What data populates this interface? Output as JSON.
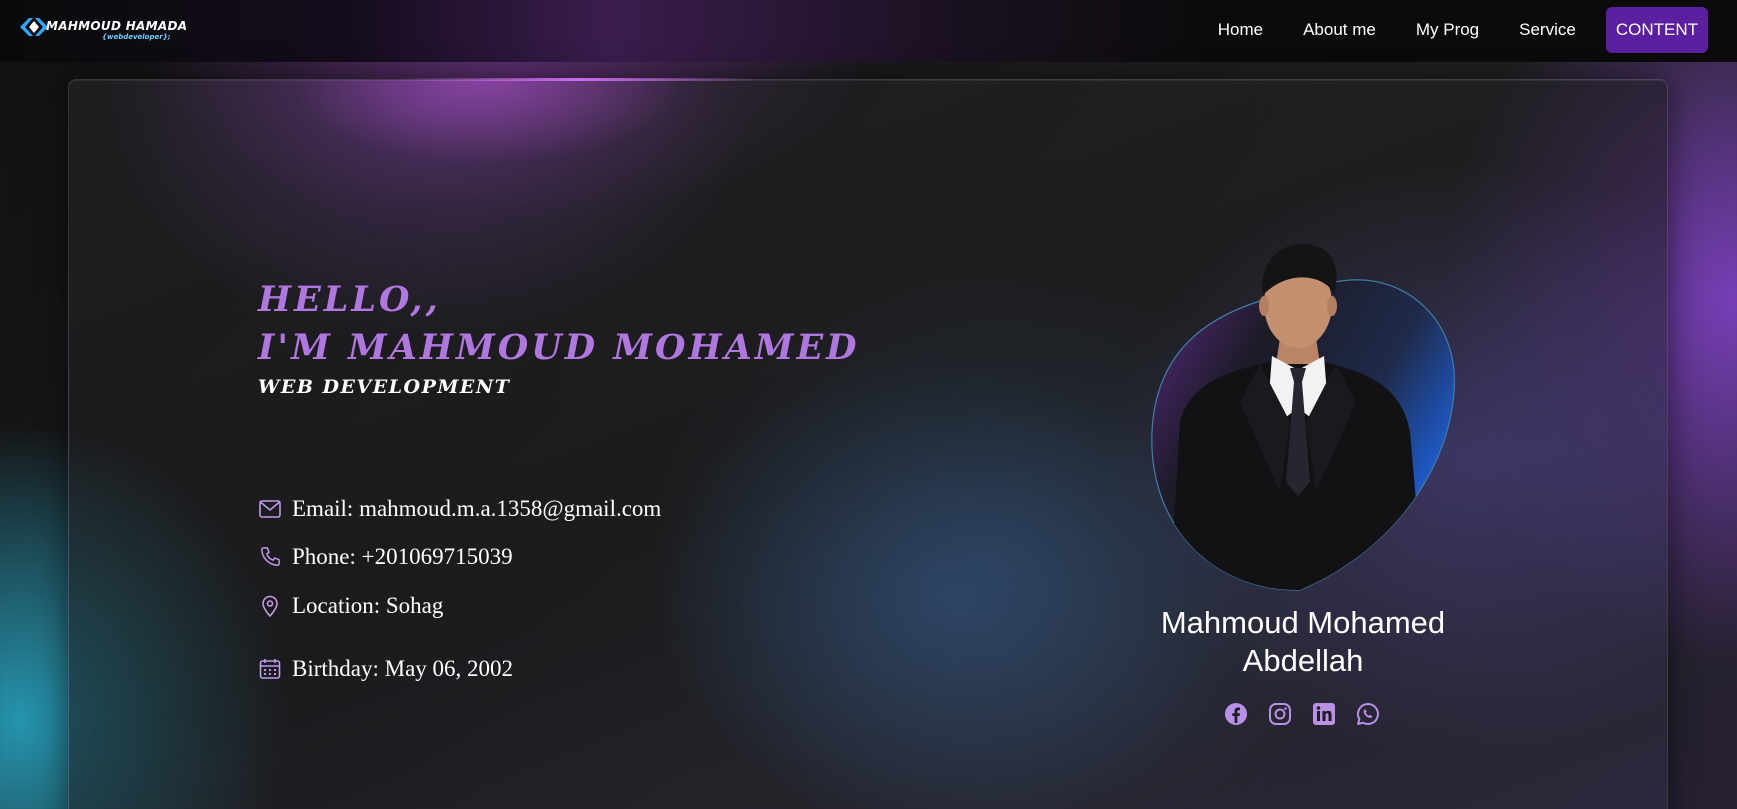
{
  "nav": {
    "logo_name": "MAHMOUD HAMADA",
    "logo_sub": "{webdeveloper};",
    "links": [
      "Home",
      "About me",
      "My Prog",
      "Service"
    ],
    "cta": "CONTENT"
  },
  "intro": {
    "hello": "HELLO,,",
    "name_line": "I'M MAHMOUD MOHAMED",
    "role": "WEB DEVELOPMENT"
  },
  "contacts": {
    "email": "Email: mahmoud.m.a.1358@gmail.com",
    "phone": "Phone: +201069715039",
    "location": "Location: Sohag",
    "birthday": "Birthday: May 06, 2002"
  },
  "profile": {
    "name_line1": "Mahmoud Mohamed",
    "name_line2": "Abdellah"
  },
  "socials": [
    "facebook-icon",
    "instagram-icon",
    "linkedin-icon",
    "whatsapp-icon"
  ],
  "colors": {
    "accent": "#b177e0",
    "cta_bg": "#5c1fa0",
    "icon": "#c09ae8",
    "social": "#b890e6"
  }
}
